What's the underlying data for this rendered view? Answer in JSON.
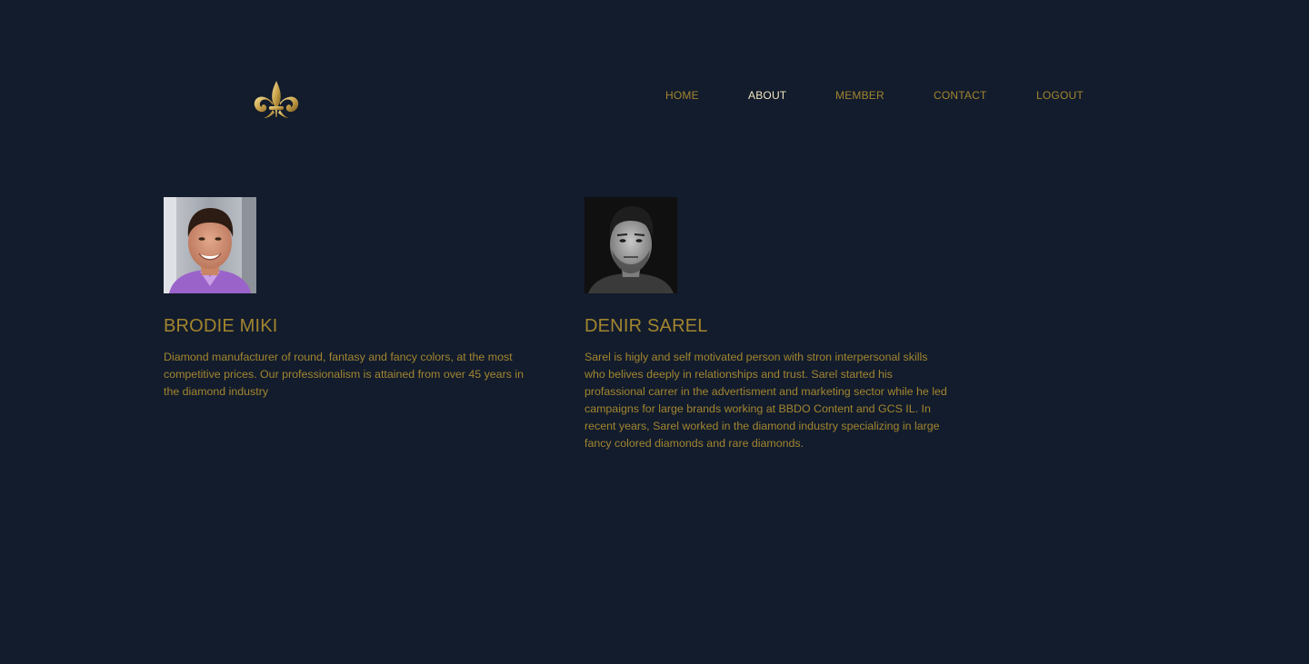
{
  "brand": {
    "logo_icon": "fleur-de-lis-icon",
    "accent_color": "#a3852f",
    "background_color": "#121c2c"
  },
  "nav": {
    "items": [
      {
        "label": "HOME"
      },
      {
        "label": "ABOUT",
        "active": true
      },
      {
        "label": "MEMBER"
      },
      {
        "label": "CONTACT"
      },
      {
        "label": "LOGOUT"
      }
    ]
  },
  "members": [
    {
      "name": "BRODIE MIKI",
      "bio": "Diamond manufacturer of round, fantasy and fancy colors, at the most competitive prices. Our professionalism is attained from over 45 years in the diamond industry"
    },
    {
      "name": "DENIR SAREL",
      "bio": "Sarel is higly and self motivated person with stron interpersonal skills who belives deeply in relationships and trust. Sarel started his profassional carrer in the advertisment and marketing sector while he led campaigns for large brands working at BBDO Content and GCS IL. In recent years, Sarel worked in the diamond industry specializing in large fancy colored diamonds and rare diamonds."
    }
  ]
}
